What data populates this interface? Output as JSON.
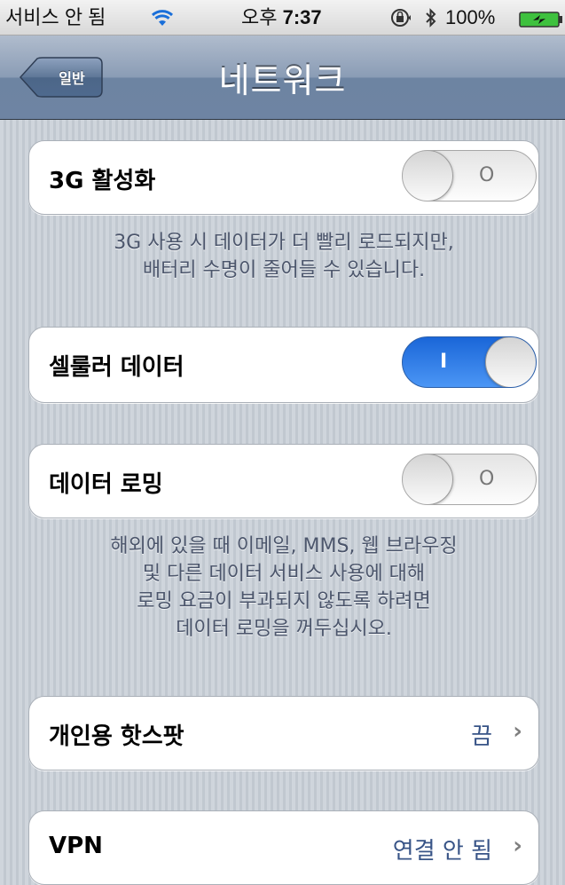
{
  "status_bar": {
    "carrier": "서비스 안 됨",
    "time_prefix": "오후",
    "time": "7:37",
    "battery_pct": "100%",
    "icons": [
      "wifi-icon",
      "rotation-lock-icon",
      "bluetooth-icon",
      "battery-charging-icon"
    ]
  },
  "nav": {
    "back_label": "일반",
    "title": "네트워크"
  },
  "settings": {
    "three_g": {
      "label": "3G 활성화",
      "state": "off",
      "glyph": "O"
    },
    "three_g_footer": [
      "3G 사용 시 데이터가 더 빨리 로드되지만,",
      "배터리 수명이 줄어들 수 있습니다."
    ],
    "cellular": {
      "label": "셀룰러 데이터",
      "state": "on",
      "glyph": "I"
    },
    "roaming": {
      "label": "데이터 로밍",
      "state": "off",
      "glyph": "O"
    },
    "roaming_footer": [
      "해외에 있을 때 이메일, MMS, 웹 브라우징",
      "및 다른 데이터 서비스 사용에 대해",
      "로밍 요금이 부과되지 않도록 하려면",
      "데이터 로밍을 꺼두십시오."
    ],
    "hotspot": {
      "label": "개인용 핫스팟",
      "value": "끔"
    },
    "vpn": {
      "label": "VPN",
      "value": "연결 안 됨"
    }
  },
  "colors": {
    "background": "#c5ccd4",
    "nav_bar": "#6e84a3",
    "toggle_on": "#2f7ae5",
    "value_text": "#385487",
    "footer_text": "#4c566c",
    "battery_green": "#3ec13e"
  }
}
